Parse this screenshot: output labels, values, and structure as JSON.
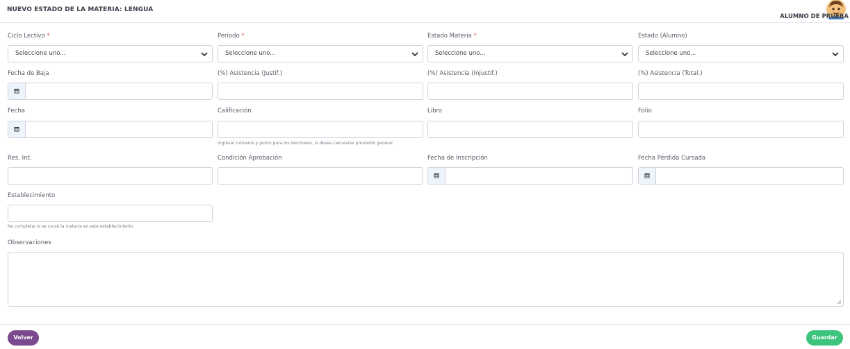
{
  "header": {
    "title": "NUEVO ESTADO DE LA MATERIA: LENGUA",
    "user_name": "ALUMNO DE PRUEBA"
  },
  "form": {
    "ciclo_lectivo": {
      "label": "Ciclo Lectivo",
      "required": "*",
      "value": "Seleccione uno..."
    },
    "periodo": {
      "label": "Periodo",
      "required": "*",
      "value": "Seleccione uno..."
    },
    "estado_materia": {
      "label": "Estado Materia",
      "required": "*",
      "value": "Seleccione uno..."
    },
    "estado_alumno": {
      "label": "Estado (Alumno)",
      "value": "Seleccione uno..."
    },
    "fecha_baja": {
      "label": "Fecha de Baja",
      "value": ""
    },
    "asistencia_justif": {
      "label": "(%) Asistencia (Justif.)",
      "value": ""
    },
    "asistencia_injustif": {
      "label": "(%) Asistencia (Injustif.)",
      "value": ""
    },
    "asistencia_total": {
      "label": "(%) Asistencia (Total.)",
      "value": ""
    },
    "fecha": {
      "label": "Fecha",
      "value": ""
    },
    "calificacion": {
      "label": "Calificación",
      "value": "",
      "help": "Ingresar números y punto para los decimales, si desea calcularse promedio general"
    },
    "libro": {
      "label": "Libro",
      "value": ""
    },
    "folio": {
      "label": "Folio",
      "value": ""
    },
    "res_int": {
      "label": "Res. Int.",
      "value": ""
    },
    "condicion_aprobacion": {
      "label": "Condición Aprobación",
      "value": ""
    },
    "fecha_inscripcion": {
      "label": "Fecha de Inscripción",
      "value": ""
    },
    "fecha_perdida": {
      "label": "Fecha Pérdida Cursada",
      "value": ""
    },
    "establecimiento": {
      "label": "Establecimiento",
      "value": "",
      "help": "No completar si se cursó la materia en este establecimiento"
    },
    "observaciones": {
      "label": "Observaciones",
      "value": ""
    }
  },
  "footer": {
    "back_label": "Volver",
    "save_label": "Guardar"
  },
  "colors": {
    "back_button": "#7b4a8e",
    "save_button": "#3cc47c",
    "required_mark": "#e0523f"
  },
  "icons": {
    "date_addon": "calendar-icon",
    "select_arrow": "chevron-down-icon",
    "user": "avatar"
  }
}
